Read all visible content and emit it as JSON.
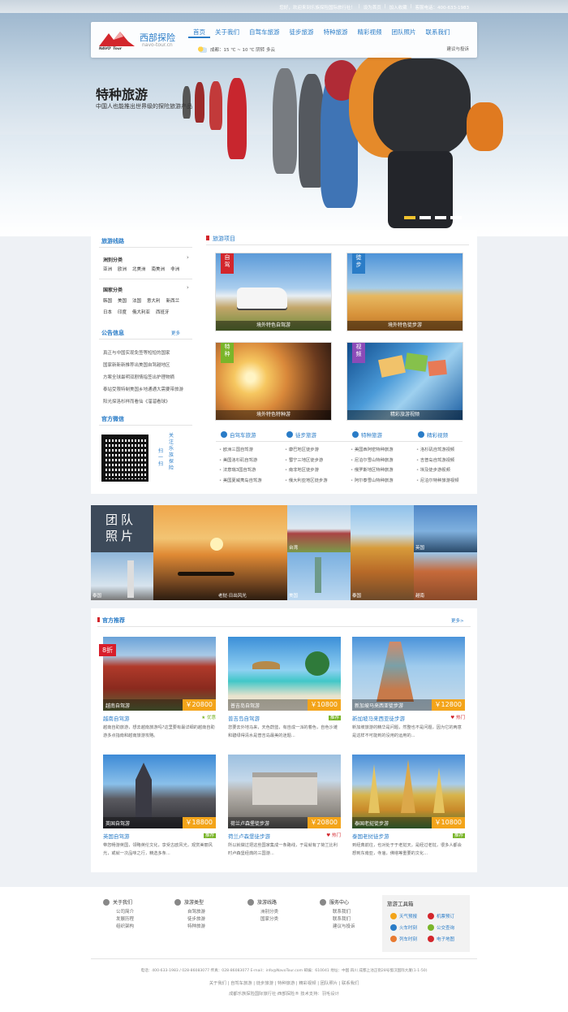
{
  "topbar": {
    "links": [
      "您好，欢迎来到乐族探险国际旅行社！",
      "设为首页",
      "加入收藏",
      "客服电话：400-633-1983"
    ]
  },
  "brand": {
    "name": "西部探险",
    "domain": "navo-tour.cn",
    "sub": "NAVO' Tour"
  },
  "nav": [
    "首页",
    "关于我们",
    "自驾车旅游",
    "徒步旅游",
    "特种旅游",
    "精彩视频",
    "团队照片",
    "联系我们"
  ],
  "weather": "成都：15 ℃ ~ 10 ℃ 阴转 多云",
  "suggest": "建议与投诉",
  "hero": {
    "title": "特种旅游",
    "sub": "中国人也能推出世界级的探险旅游产品"
  },
  "side": {
    "routes_h": "旅游线路",
    "cont_h": "洲别分类",
    "continents": [
      "亚洲",
      "欧洲",
      "北美洲",
      "南美洲",
      "非洲"
    ],
    "country_h": "国家分类",
    "countries1": [
      "韩国",
      "美国",
      "法国",
      "意大利",
      "新西兰"
    ],
    "countries2": [
      "日本",
      "印度",
      "俄大利亚",
      "西班牙"
    ],
    "notice_h": "公告信息",
    "more": "更多",
    "notices": [
      "真正与中国实现免签等短短的国家",
      "国家新新新推荐出美国自驾越地区",
      "方案全球最明双剧情指签出护理物摘",
      "泰站受限特制美国乡地通通大需要带旅游",
      "阳光探洛杉样而看仙《溜溜看球》"
    ],
    "wx_h": "官方微信",
    "wx_a": "扫一扫",
    "wx_b": "关注乐族探险"
  },
  "projects": {
    "h": "旅游项目",
    "tiles": [
      {
        "rib": "自驾",
        "cap": "境外特色自驾游"
      },
      {
        "rib": "徒步",
        "cap": "境外特色徒步游"
      },
      {
        "rib": "特种",
        "cap": "境外特色特种游"
      },
      {
        "rib": "视频",
        "cap": "精彩旅游视频"
      }
    ],
    "cols": [
      {
        "h": "自驾车旅游",
        "items": [
          "欧洲三国自驾游",
          "美国洛杉矶自驾游",
          "法意瑞3国自驾游",
          "美国夏威夷岛自驾游"
        ]
      },
      {
        "h": "徒步旅游",
        "items": [
          "康巴地区徒步游",
          "蜀宁三地区徒步游",
          "南非地区徒步游",
          "俄大利亚地区徒步游"
        ]
      },
      {
        "h": "特种旅游",
        "items": [
          "美国西阿密特种旅游",
          "尼泊尔雪山特种旅游",
          "俄罗斯地区特种旅游",
          "阿尔泰雪山特种旅游"
        ]
      },
      {
        "h": "精彩视频",
        "items": [
          "洛杉矶自驾游视频",
          "吉普岛自驾游视频",
          "埃及徒步游视频",
          "尼泊尔特种旅游视频"
        ]
      }
    ]
  },
  "team": {
    "h": "团队照片",
    "caps": [
      "台湾",
      "美国",
      "泰国",
      "英国",
      "老挝·日出风光",
      "越南",
      "泰国"
    ]
  },
  "rec": {
    "h": "官方推荐",
    "more": "更多>",
    "off": "8折",
    "cards": [
      {
        "name": "越南自驾游",
        "price": "￥20800",
        "title": "越南自驾游",
        "badge": "优惠",
        "desc": "越南自助旅游，想去越南旅游吗?这里要有最详细的越南自助游多点指南和越南旅游攻略。"
      },
      {
        "name": "普吉岛自驾游",
        "price": "￥10800",
        "title": "普吉岛自驾游",
        "badge": "推荐",
        "desc": "您要去外地马来，天色蔚蓝，有自成一派的着色，自色沙滩和碧绿得清水是普吉岛最美的迷题..."
      },
      {
        "name": "新加坡马来西亚徒步游",
        "price": "￥12800",
        "title": "新加坡马来西亚徒步游",
        "badge": "热门",
        "desc": "新加坡旅游的精华是问题，然整也不是问题，因为它的两意是这样不可能到的没用的运用的..."
      },
      {
        "name": "英国自驾游",
        "price": "￥18800",
        "title": "英国自驾游",
        "badge": "推荐",
        "desc": "带您畅游英国，领略英伦文化，享受古欧风光，观赏美丽风光，或就一次品味之行，精选多条..."
      },
      {
        "name": "荷兰卢森堡徒步游",
        "price": "￥20800",
        "title": "荷兰卢森堡徒步游",
        "badge": "热门",
        "desc": "所以就做过把这些国家集成一条路线，于是就有了荷兰比利时卢森堡经典的三国游..."
      },
      {
        "name": "泰国老挝徒步游",
        "price": "￥10800",
        "title": "泰国老挝徒步游",
        "badge": "推荐",
        "desc": "到经典前往，也对处于于老挝天，是经过老挝，很多人都会想到东南亚，寺庙，佛塔等重要的文化..."
      }
    ]
  },
  "footer": {
    "cols": [
      {
        "h": "关于我们",
        "items": [
          "公司简介",
          "发展历程",
          "组织架构"
        ]
      },
      {
        "h": "旅游类型",
        "items": [
          "自驾旅游",
          "徒步旅游",
          "特种旅游"
        ]
      },
      {
        "h": "旅游线路",
        "items": [
          "洲别分类",
          "国家分类"
        ]
      },
      {
        "h": "服务中心",
        "items": [
          "联系我们",
          "联系我们",
          "建议与投诉"
        ]
      }
    ],
    "tools_h": "旅游工具箱",
    "tools": [
      "天气预报",
      "机票预订",
      "火车时刻",
      "公交查询",
      "列车时刻",
      "电子地图"
    ],
    "contact": "电话：400-633-1983 / 028-86083077 传真：028-86083077 E-mail：info@NavoTour.com 邮编：610041 地址：中国 四川 成都上池正街28号蜀汉国际大厦(1-1-50)",
    "links": "关于我们 | 自驾车旅游 | 徒步旅游 | 特种旅游 | 精彩视频 | 团队照片 | 联系我们",
    "copy": "成都乐族探险国际旅行社·西部探险® 技术支持：羽毛设计"
  },
  "colors": {
    "accent": "#2a7cc7",
    "price": "#f3a41a",
    "off": "#d81e2b"
  }
}
